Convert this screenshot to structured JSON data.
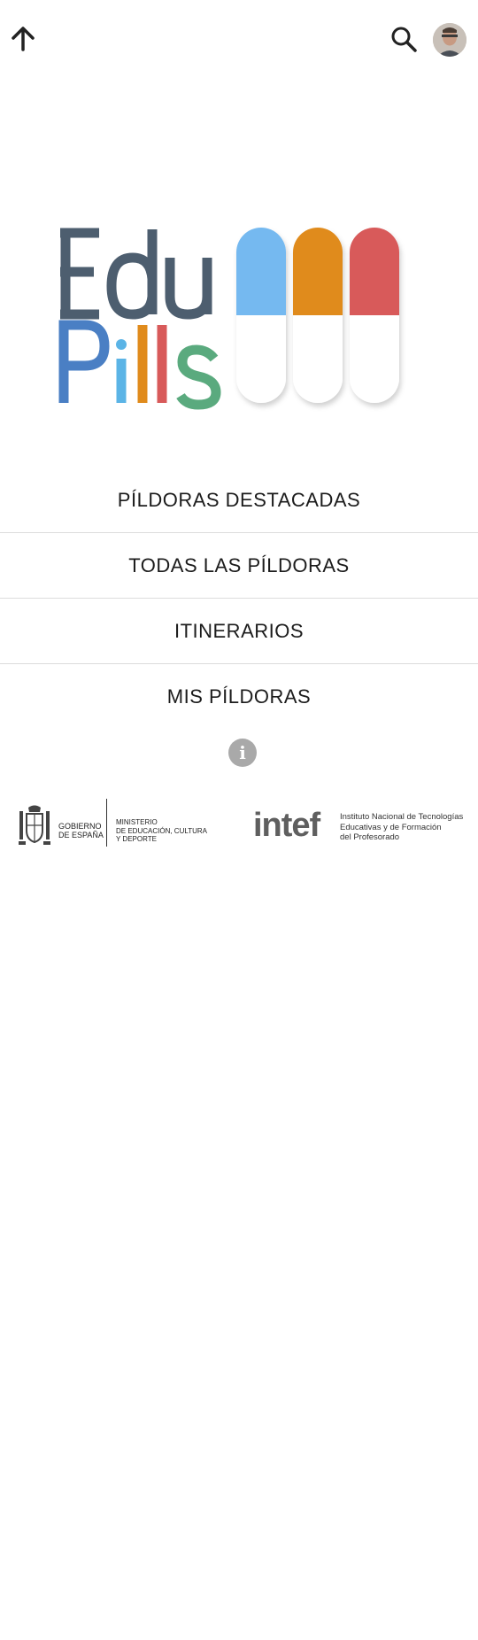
{
  "header": {
    "back_icon": "arrow-up-icon",
    "search_icon": "search-icon",
    "avatar": "user-avatar"
  },
  "logo": {
    "line1": "Edu",
    "line2_letters": [
      "P",
      "i",
      "l",
      "l",
      "s"
    ],
    "colors": {
      "edu": "#4d5e6f",
      "p": "#4a7fc4",
      "i": "#5bb4e6",
      "l1": "#e08b1c",
      "l2": "#d85a5a",
      "s": "#5aaa7e",
      "pill1": "#74b9f0",
      "pill2": "#e08b1c",
      "pill3": "#d85a5a"
    }
  },
  "menu": {
    "items": [
      {
        "label": "PÍLDORAS DESTACADAS"
      },
      {
        "label": "TODAS LAS PÍLDORAS"
      },
      {
        "label": "ITINERARIOS"
      },
      {
        "label": "MIS PÍLDORAS"
      }
    ]
  },
  "info": {
    "glyph": "i"
  },
  "footer": {
    "gobierno": "GOBIERNO\nDE ESPAÑA",
    "ministerio": "MINISTERIO\nDE EDUCACIÓN, CULTURA\nY DEPORTE",
    "intef_word": "intef",
    "intef_desc": "Instituto Nacional de Tecnologías\nEducativas y de Formación\ndel Profesorado"
  }
}
